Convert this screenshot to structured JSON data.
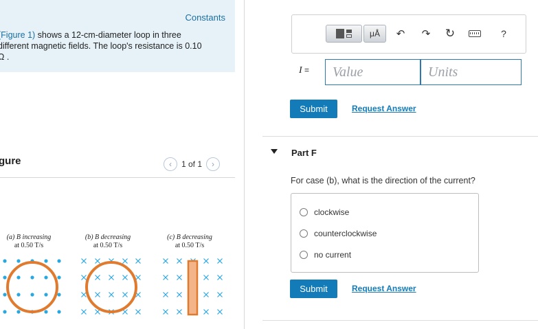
{
  "intro": {
    "constants_link": "Constants",
    "figure_link": "(Figure 1)",
    "text_rest": " shows a 12-cm-diameter loop in three different magnetic fields. The loop's resistance is 0.10 Ω ."
  },
  "figure_panel": {
    "title": "gure",
    "pager": "1 of 1",
    "captions": [
      {
        "line1": "(a) B increasing",
        "line2": "at 0.50 T/s"
      },
      {
        "line1": "(b) B decreasing",
        "line2": "at 0.50 T/s"
      },
      {
        "line1": "(c) B decreasing",
        "line2": "at 0.50 T/s"
      }
    ],
    "colors": {
      "loop": "#e07a2e",
      "dots": "#29a8e0",
      "cross": "#29a8e0",
      "rod_fill": "#f4b48a"
    }
  },
  "answer_box": {
    "toolbar_units": "μÅ",
    "help": "?",
    "variable_label": "I",
    "equals": " =",
    "value_placeholder": "Value",
    "units_placeholder": "Units",
    "submit_label": "Submit",
    "request_label": "Request Answer"
  },
  "part_f": {
    "title": "Part F",
    "question": "For case (b), what is the direction of the current?",
    "options": [
      "clockwise",
      "counterclockwise",
      "no current"
    ],
    "submit_label": "Submit",
    "request_label": "Request Answer"
  }
}
